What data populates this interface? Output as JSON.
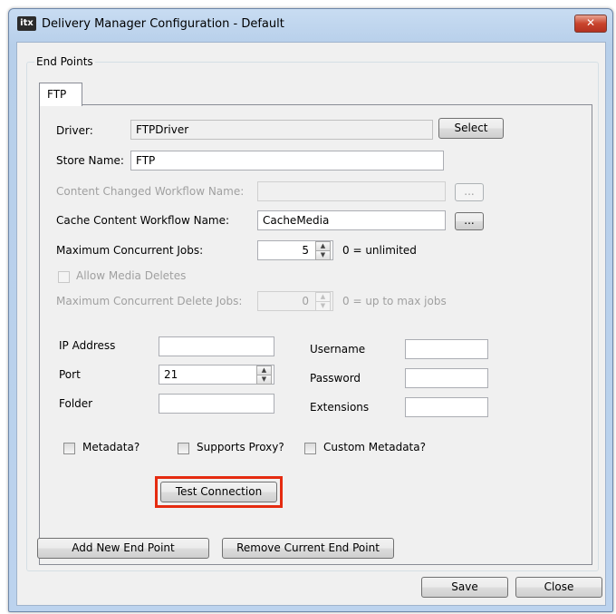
{
  "window": {
    "title": "Delivery Manager Configuration - Default",
    "app_icon": "itx",
    "close_glyph": "✕"
  },
  "endpoints": {
    "group_label": "End Points",
    "tabs": [
      {
        "label": "FTP",
        "active": true
      }
    ],
    "driver": {
      "label": "Driver:",
      "value": "FTPDriver",
      "select_label": "Select"
    },
    "store_name": {
      "label": "Store Name:",
      "value": "FTP"
    },
    "content_changed": {
      "label": "Content Changed Workflow Name:",
      "value": "",
      "browse_label": "...",
      "enabled": false
    },
    "cache_content": {
      "label": "Cache Content Workflow Name:",
      "value": "CacheMedia",
      "browse_label": "..."
    },
    "max_jobs": {
      "label": "Maximum Concurrent Jobs:",
      "value": "5",
      "hint": "0 = unlimited"
    },
    "allow_deletes": {
      "label": "Allow Media Deletes",
      "checked": false,
      "enabled": false
    },
    "max_delete_jobs": {
      "label": "Maximum Concurrent Delete Jobs:",
      "value": "0",
      "hint": "0 = up to max jobs",
      "enabled": false
    },
    "ip_address": {
      "label": "IP Address",
      "value": ""
    },
    "port": {
      "label": "Port",
      "value": "21"
    },
    "folder": {
      "label": "Folder",
      "value": ""
    },
    "username": {
      "label": "Username",
      "value": ""
    },
    "password": {
      "label": "Password",
      "value": ""
    },
    "extensions": {
      "label": "Extensions",
      "value": ""
    },
    "metadata": {
      "label": "Metadata?",
      "checked": false
    },
    "supports_proxy": {
      "label": "Supports Proxy?",
      "checked": false
    },
    "custom_metadata": {
      "label": "Custom Metadata?",
      "checked": false
    },
    "test_connection_label": "Test Connection",
    "highlight_color": "#e52b10"
  },
  "footer": {
    "add_label": "Add New End Point",
    "remove_label": "Remove Current End Point",
    "save_label": "Save",
    "close_label": "Close"
  },
  "spinner_glyphs": {
    "up": "▲",
    "down": "▼"
  }
}
